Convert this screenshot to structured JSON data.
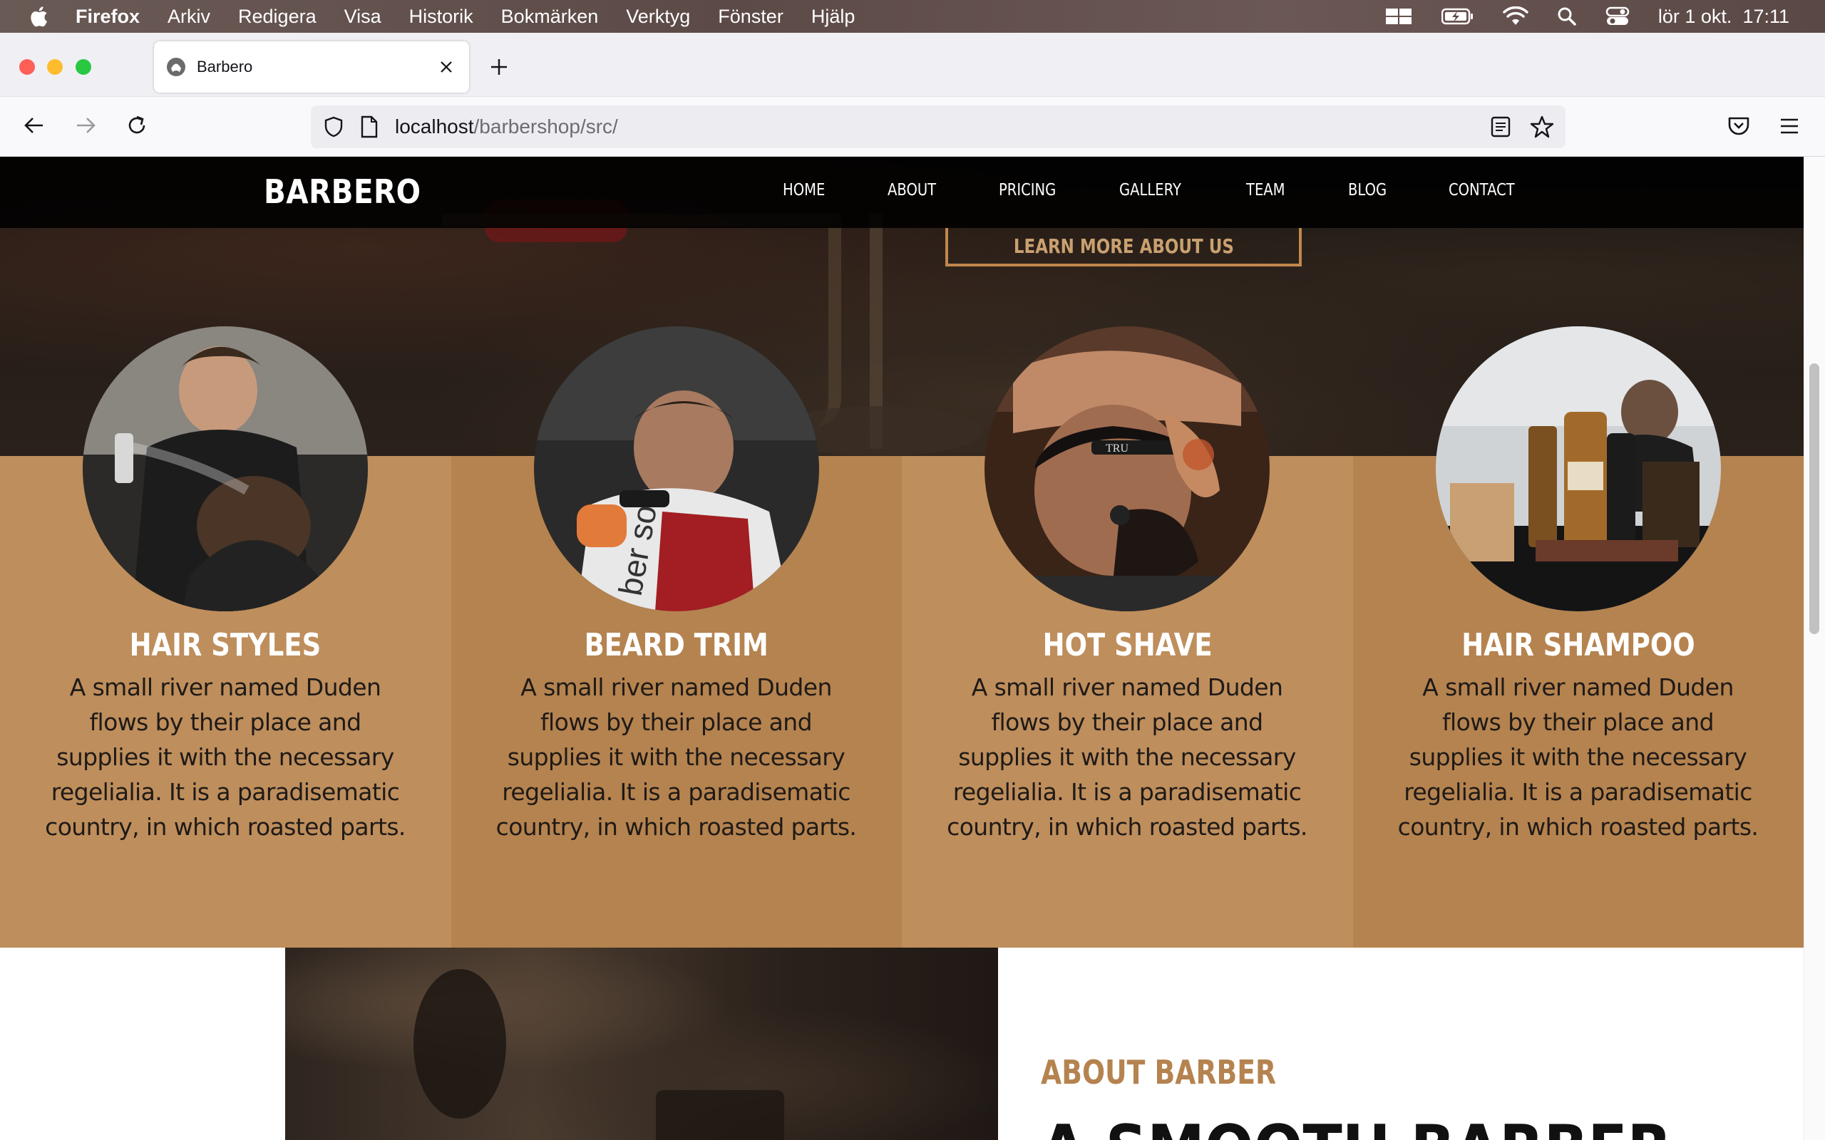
{
  "menubar": {
    "app": "Firefox",
    "items": [
      "Arkiv",
      "Redigera",
      "Visa",
      "Historik",
      "Bokmärken",
      "Verktyg",
      "Fönster",
      "Hjälp"
    ],
    "clock": "lör 1 okt.  17:11",
    "status_icons": [
      "display-icon",
      "battery-icon",
      "wifi-icon",
      "search-icon",
      "control-center-icon"
    ]
  },
  "browser": {
    "tab_title": "Barbero",
    "url_host": "localhost",
    "url_path": "/barbershop/src/"
  },
  "site": {
    "logo": "BARBERO",
    "nav": [
      "HOME",
      "ABOUT",
      "PRICING",
      "GALLERY",
      "TEAM",
      "BLOG",
      "CONTACT"
    ],
    "learn_more": "LEARN MORE ABOUT US",
    "services": [
      {
        "title": "HAIR STYLES",
        "desc": "A small river named Duden flows by their place and supplies it with the necessary regelialia. It is a paradisematic country, in which roasted parts.",
        "image": "barber-spraying-hair-photo"
      },
      {
        "title": "BEARD TRIM",
        "desc": "A small river named Duden flows by their place and supplies it with the necessary regelialia. It is a paradisematic country, in which roasted parts.",
        "image": "beard-trim-photo"
      },
      {
        "title": "HOT SHAVE",
        "desc": "A small river named Duden flows by their place and supplies it with the necessary regelialia. It is a paradisematic country, in which roasted parts.",
        "image": "hot-shave-razor-photo"
      },
      {
        "title": "HAIR SHAMPOO",
        "desc": "A small river named Duden flows by their place and supplies it with the necessary regelialia. It is a paradisematic country, in which roasted parts.",
        "image": "hair-products-photo"
      }
    ],
    "about_label": "ABOUT BARBER",
    "about_heading": "A SMOOTH BARBER"
  },
  "colors": {
    "accent": "#b5834f",
    "accent_light": "#be8e5c",
    "header_bg": "#000000"
  }
}
